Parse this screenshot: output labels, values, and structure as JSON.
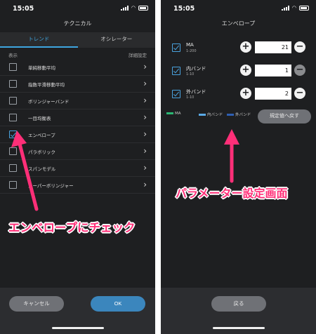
{
  "left_screen": {
    "status_time": "15:05",
    "title": "テクニカル",
    "tabs": [
      "トレンド",
      "オシレーター"
    ],
    "col_header_left": "表示",
    "col_header_right": "詳細設定",
    "items": [
      {
        "label": "単純移動平均",
        "checked": false
      },
      {
        "label": "指数平滑移動平均",
        "checked": false
      },
      {
        "label": "ボリンジャーバンド",
        "checked": false
      },
      {
        "label": "一目均衡表",
        "checked": false
      },
      {
        "label": "エンベロープ",
        "checked": true
      },
      {
        "label": "パラボリック",
        "checked": false
      },
      {
        "label": "スパンモデル",
        "checked": false
      },
      {
        "label": "スーパーボリンジャー",
        "checked": false
      }
    ],
    "cancel_label": "キャンセル",
    "ok_label": "OK"
  },
  "right_screen": {
    "status_time": "15:05",
    "title": "エンベロープ",
    "params": [
      {
        "name": "MA",
        "range": "1-200",
        "value": "21"
      },
      {
        "name": "内バンド",
        "range": "1-10",
        "value": "1"
      },
      {
        "name": "外バンド",
        "range": "1-10",
        "value": "2"
      }
    ],
    "legend": [
      {
        "label": "MA",
        "color": "#2bb673"
      },
      {
        "label": "内バンド",
        "color": "#5aa9e6"
      },
      {
        "label": "外バンド",
        "color": "#2f5fb3"
      }
    ],
    "reset_label": "規定値へ戻す",
    "back_label": "戻る"
  },
  "annotations": {
    "left": "エンベロープにチェック",
    "right": "パラメーター設定画面",
    "color": "#ff2f78"
  }
}
